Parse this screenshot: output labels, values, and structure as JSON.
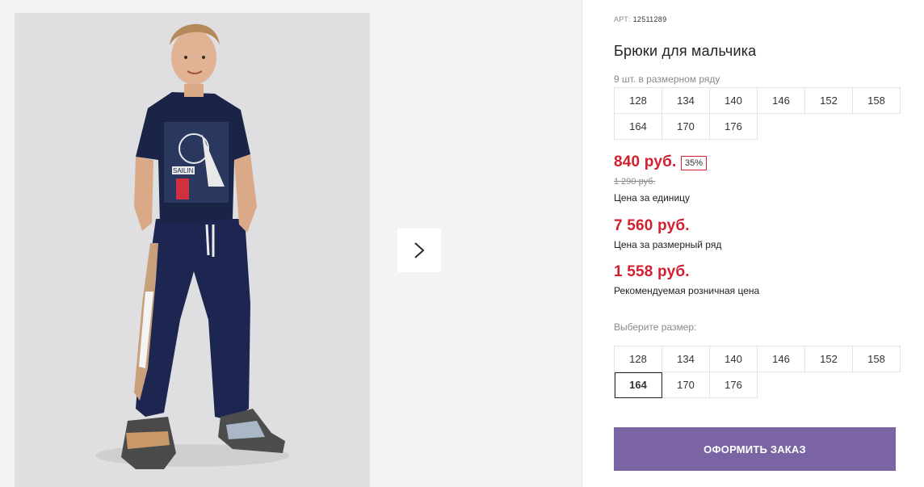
{
  "product": {
    "article_label": "АРТ:",
    "article_number": "12511289",
    "title": "Брюки для мальчика",
    "pack_note": "9 шт. в размерном ряду",
    "size_row": [
      "128",
      "134",
      "140",
      "146",
      "152",
      "158",
      "164",
      "170",
      "176"
    ]
  },
  "pricing": {
    "unit_price": "840 руб.",
    "discount": "35%",
    "old_price": "1 290 руб.",
    "unit_caption": "Цена за единицу",
    "row_price": "7 560 руб.",
    "row_caption": "Цена за размерный ряд",
    "retail_price": "1 558 руб.",
    "retail_caption": "Рекомендуемая розничная цена"
  },
  "size_select": {
    "label": "Выберите размер:",
    "options": [
      "128",
      "134",
      "140",
      "146",
      "152",
      "158",
      "164",
      "170",
      "176"
    ],
    "selected": "164"
  },
  "actions": {
    "order_label": "ОФОРМИТЬ ЗАКАЗ"
  },
  "gallery": {
    "next_icon": "chevron-right-icon",
    "photo": "product-photo"
  },
  "colors": {
    "price_red": "#d31f2f",
    "order_button": "#7a64a3",
    "shirt": "#1a2447",
    "pants": "#1c2650"
  }
}
